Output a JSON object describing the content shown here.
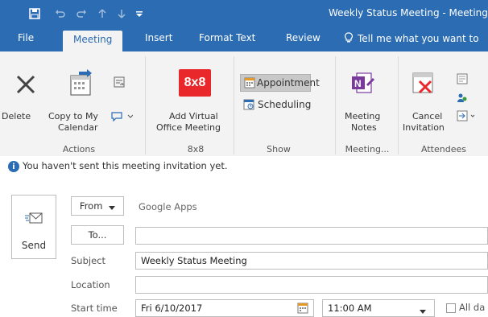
{
  "window": {
    "title": "Weekly Status Meeting - Meeting"
  },
  "tabs": [
    {
      "label": "File"
    },
    {
      "label": "Meeting"
    },
    {
      "label": "Insert"
    },
    {
      "label": "Format Text"
    },
    {
      "label": "Review"
    },
    {
      "label": "Tell me what you want to"
    }
  ],
  "ribbon": {
    "actions": {
      "delete_label": "Delete",
      "copy_label_1": "Copy to My",
      "copy_label_2": "Calendar",
      "group_label": "Actions"
    },
    "eightxeight": {
      "logo_text": "8x8",
      "label_1": "Add Virtual",
      "label_2": "Office Meeting",
      "group_label": "8x8"
    },
    "show": {
      "appointment_label": "Appointment",
      "scheduling_label": "Scheduling",
      "group_label": "Show"
    },
    "meeting_notes": {
      "label_1": "Meeting",
      "label_2": "Notes",
      "group_label": "Meeting..."
    },
    "attendees": {
      "label_1": "Cancel",
      "label_2": "Invitation",
      "group_label": "Attendees"
    }
  },
  "infobar": {
    "text": "You haven't sent this meeting invitation yet."
  },
  "form": {
    "send_label": "Send",
    "from_label": "From",
    "from_value": "Google Apps",
    "to_label": "To...",
    "subject_label": "Subject",
    "subject_value": "Weekly Status Meeting",
    "location_label": "Location",
    "location_value": "",
    "start_label": "Start time",
    "start_date": "Fri 6/10/2017",
    "start_time": "11:00 AM",
    "allday_label": "All da"
  },
  "colors": {
    "accent": "#2b6cb3",
    "eightxeight": "#e8282b"
  }
}
